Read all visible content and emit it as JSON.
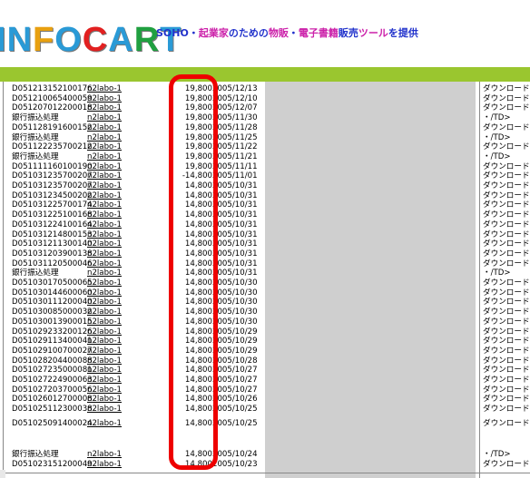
{
  "header": {
    "logo_letters": [
      {
        "ch": "I",
        "color": "#2a9ad6"
      },
      {
        "ch": "N",
        "color": "#2a9ad6"
      },
      {
        "ch": "F",
        "color": "#e8a010"
      },
      {
        "ch": "O",
        "color": "#2a9ad6"
      },
      {
        "ch": "C",
        "color": "#e22020"
      },
      {
        "ch": "A",
        "color": "#2a9ad6"
      },
      {
        "ch": "R",
        "color": "#20a040"
      },
      {
        "ch": "T",
        "color": "#2a9ad6"
      }
    ],
    "tagline_parts": [
      {
        "text": "SOHO・",
        "color": "#2233cc"
      },
      {
        "text": "起業家",
        "color": "#cc22aa"
      },
      {
        "text": "のための",
        "color": "#2233cc"
      },
      {
        "text": "物販",
        "color": "#cc22aa"
      },
      {
        "text": "・",
        "color": "#2233cc"
      },
      {
        "text": "電子書籍",
        "color": "#cc22aa"
      },
      {
        "text": "販売",
        "color": "#2233cc"
      },
      {
        "text": "ツール",
        "color": "#cc22aa"
      },
      {
        "text": "を提供",
        "color": "#2233cc"
      }
    ]
  },
  "colors": {
    "green_bar": "#9ac62f",
    "highlight_border": "#ee0000",
    "grey_column": "#cfcfcf"
  },
  "rows": [
    {
      "id": "D051213152100176",
      "user": "n2labo-1",
      "amount": "19,800",
      "date": "2005/12/13",
      "status": "ダウンロード"
    },
    {
      "id": "D051210065400059",
      "user": "n2labo-1",
      "amount": "19,800",
      "date": "2005/12/10",
      "status": "ダウンロード"
    },
    {
      "id": "D051207012200018",
      "user": "n2labo-1",
      "amount": "19,800",
      "date": "2005/12/07",
      "status": "ダウンロード"
    },
    {
      "id": "銀行振込処理",
      "user": "n2labo-1",
      "amount": "19,800",
      "date": "2005/11/30",
      "status": "・/TD>"
    },
    {
      "id": "D051128191600152",
      "user": "n2labo-1",
      "amount": "19,800",
      "date": "2005/11/28",
      "status": "ダウンロード"
    },
    {
      "id": "銀行振込処理",
      "user": "n2labo-1",
      "amount": "19,800",
      "date": "2005/11/25",
      "status": "・/TD>"
    },
    {
      "id": "D051122235700212",
      "user": "n2labo-1",
      "amount": "19,800",
      "date": "2005/11/22",
      "status": "ダウンロード"
    },
    {
      "id": "銀行振込処理",
      "user": "n2labo-1",
      "amount": "19,800",
      "date": "2005/11/21",
      "status": "・/TD>"
    },
    {
      "id": "D051111160100190",
      "user": "n2labo-1",
      "amount": "19,800",
      "date": "2005/11/11",
      "status": "ダウンロード"
    },
    {
      "id": "D051031235700207",
      "user": "n2labo-1",
      "amount": "-14,800",
      "date": "2005/11/01",
      "status": "ダウンロード"
    },
    {
      "id": "D051031235700207",
      "user": "n2labo-1",
      "amount": "14,800",
      "date": "2005/10/31",
      "status": "ダウンロード"
    },
    {
      "id": "D051031234500202",
      "user": "n2labo-1",
      "amount": "14,800",
      "date": "2005/10/31",
      "status": "ダウンロード"
    },
    {
      "id": "D051031225700174",
      "user": "n2labo-1",
      "amount": "14,800",
      "date": "2005/10/31",
      "status": "ダウンロード"
    },
    {
      "id": "D051031225100168",
      "user": "n2labo-1",
      "amount": "14,800",
      "date": "2005/10/31",
      "status": "ダウンロード"
    },
    {
      "id": "D051031224100164",
      "user": "n2labo-1",
      "amount": "14,800",
      "date": "2005/10/31",
      "status": "ダウンロード"
    },
    {
      "id": "D051031214800153",
      "user": "n2labo-1",
      "amount": "14,800",
      "date": "2005/10/31",
      "status": "ダウンロード"
    },
    {
      "id": "D051031211300140",
      "user": "n2labo-1",
      "amount": "14,800",
      "date": "2005/10/31",
      "status": "ダウンロード"
    },
    {
      "id": "D051031203900138",
      "user": "n2labo-1",
      "amount": "14,800",
      "date": "2005/10/31",
      "status": "ダウンロード"
    },
    {
      "id": "D051031120500046",
      "user": "n2labo-1",
      "amount": "14,800",
      "date": "2005/10/31",
      "status": "ダウンロード"
    },
    {
      "id": "銀行振込処理",
      "user": "n2labo-1",
      "amount": "14,800",
      "date": "2005/10/31",
      "status": "・/TD>"
    },
    {
      "id": "D051030170500065",
      "user": "n2labo-1",
      "amount": "14,800",
      "date": "2005/10/30",
      "status": "ダウンロード"
    },
    {
      "id": "D051030144600060",
      "user": "n2labo-1",
      "amount": "14,800",
      "date": "2005/10/30",
      "status": "ダウンロード"
    },
    {
      "id": "D051030111200040",
      "user": "n2labo-1",
      "amount": "14,800",
      "date": "2005/10/30",
      "status": "ダウンロード"
    },
    {
      "id": "D051030085000032",
      "user": "n2labo-1",
      "amount": "14,800",
      "date": "2005/10/30",
      "status": "ダウンロード"
    },
    {
      "id": "D051030013900015",
      "user": "n2labo-1",
      "amount": "14,800",
      "date": "2005/10/30",
      "status": "ダウンロード"
    },
    {
      "id": "D051029233200126",
      "user": "n2labo-1",
      "amount": "14,800",
      "date": "2005/10/29",
      "status": "ダウンロード"
    },
    {
      "id": "D051029113400041",
      "user": "n2labo-1",
      "amount": "14,800",
      "date": "2005/10/29",
      "status": "ダウンロード"
    },
    {
      "id": "D051029100700027",
      "user": "n2labo-1",
      "amount": "14,800",
      "date": "2005/10/29",
      "status": "ダウンロード"
    },
    {
      "id": "D051028204400088",
      "user": "n2labo-1",
      "amount": "14,800",
      "date": "2005/10/28",
      "status": "ダウンロード"
    },
    {
      "id": "D051027235000081",
      "user": "n2labo-1",
      "amount": "14,800",
      "date": "2005/10/27",
      "status": "ダウンロード"
    },
    {
      "id": "D051027224900063",
      "user": "n2labo-1",
      "amount": "14,800",
      "date": "2005/10/27",
      "status": "ダウンロード"
    },
    {
      "id": "D051027203700056",
      "user": "n2labo-1",
      "amount": "14,800",
      "date": "2005/10/27",
      "status": "ダウンロード"
    },
    {
      "id": "D051026012700008",
      "user": "n2labo-1",
      "amount": "14,800",
      "date": "2005/10/26",
      "status": "ダウンロード"
    },
    {
      "id": "D051025112300038",
      "user": "n2labo-1",
      "amount": "14,800",
      "date": "2005/10/25",
      "status": "ダウンロード"
    },
    {
      "id": "D051025091400024",
      "user": "n2labo-1",
      "amount": "14,800",
      "date": "2005/10/25",
      "status": "ダウンロード"
    },
    {
      "id": "銀行振込処理",
      "user": "n2labo-1",
      "amount": "14,800",
      "date": "2005/10/24",
      "status": "・/TD>"
    },
    {
      "id": "D051023151200049",
      "user": "n2labo-1",
      "amount": "14,800",
      "date": "2005/10/23",
      "status": "ダウンロード"
    }
  ]
}
